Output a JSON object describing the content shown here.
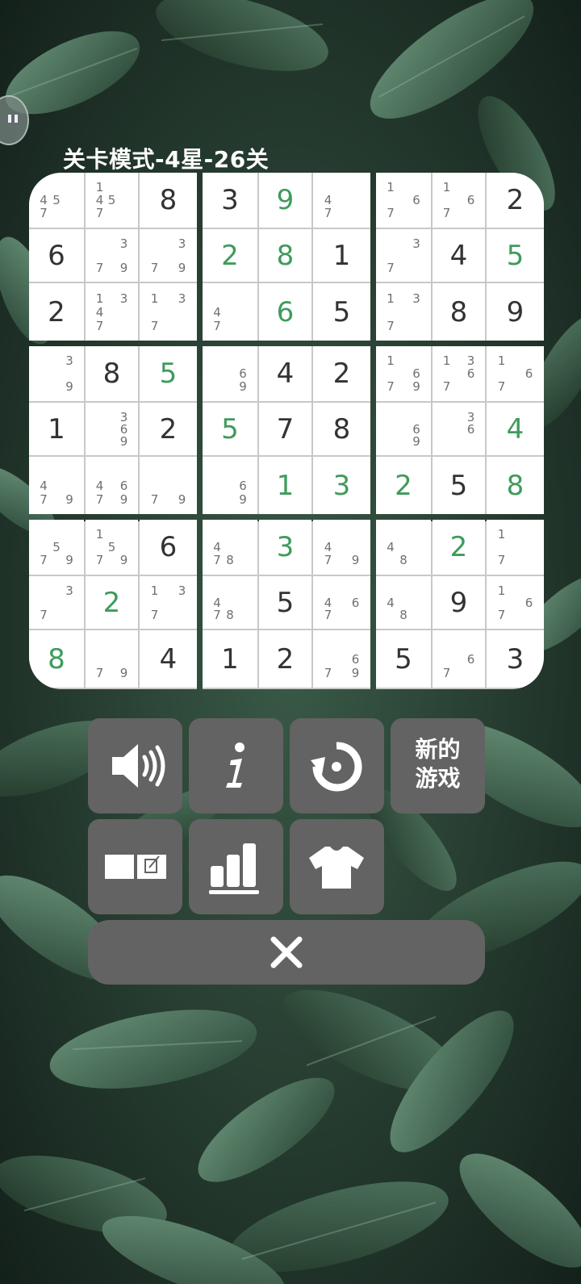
{
  "title": "关卡模式-4星-26关",
  "grid": [
    [
      {
        "n": [
          4,
          5,
          7
        ]
      },
      {
        "n": [
          1,
          4,
          5,
          7
        ]
      },
      {
        "v": 8,
        "g": 1
      },
      {
        "v": 3,
        "g": 1
      },
      {
        "v": 9,
        "g": 0
      },
      {
        "n": [
          4,
          7
        ]
      },
      {
        "n": [
          1,
          6,
          7
        ]
      },
      {
        "n": [
          1,
          6,
          7
        ]
      },
      {
        "v": 2,
        "g": 1
      }
    ],
    [
      {
        "v": 6,
        "g": 1
      },
      {
        "n": [
          3,
          7,
          9
        ]
      },
      {
        "n": [
          3,
          7,
          9
        ]
      },
      {
        "v": 2,
        "g": 0
      },
      {
        "v": 8,
        "g": 0
      },
      {
        "v": 1,
        "g": 1
      },
      {
        "n": [
          3,
          7
        ]
      },
      {
        "v": 4,
        "g": 1
      },
      {
        "v": 5,
        "g": 0
      }
    ],
    [
      {
        "v": 2,
        "g": 1
      },
      {
        "n": [
          1,
          3,
          4,
          7
        ]
      },
      {
        "n": [
          1,
          3,
          7
        ]
      },
      {
        "n": [
          4,
          7
        ]
      },
      {
        "v": 6,
        "g": 0
      },
      {
        "v": 5,
        "g": 1
      },
      {
        "n": [
          1,
          3,
          7
        ]
      },
      {
        "v": 8,
        "g": 1
      },
      {
        "v": 9,
        "g": 1
      }
    ],
    [
      {
        "n": [
          3,
          9
        ]
      },
      {
        "v": 8,
        "g": 1
      },
      {
        "v": 5,
        "g": 0
      },
      {
        "n": [
          6,
          9
        ]
      },
      {
        "v": 4,
        "g": 1
      },
      {
        "v": 2,
        "g": 1
      },
      {
        "n": [
          1,
          6,
          7,
          9
        ]
      },
      {
        "n": [
          1,
          3,
          6,
          7
        ]
      },
      {
        "n": [
          1,
          6,
          7
        ]
      }
    ],
    [
      {
        "v": 1,
        "g": 1
      },
      {
        "n": [
          3,
          6,
          9
        ]
      },
      {
        "v": 2,
        "g": 1
      },
      {
        "v": 5,
        "g": 0
      },
      {
        "v": 7,
        "g": 1
      },
      {
        "v": 8,
        "g": 1
      },
      {
        "n": [
          6,
          9
        ]
      },
      {
        "n": [
          3,
          6
        ]
      },
      {
        "v": 4,
        "g": 0
      }
    ],
    [
      {
        "n": [
          4,
          7,
          9
        ]
      },
      {
        "n": [
          4,
          6,
          7,
          9
        ]
      },
      {
        "n": [
          7,
          9
        ]
      },
      {
        "n": [
          6,
          9
        ]
      },
      {
        "v": 1,
        "g": 0
      },
      {
        "v": 3,
        "g": 0
      },
      {
        "v": 2,
        "g": 0
      },
      {
        "v": 5,
        "g": 1
      },
      {
        "v": 8,
        "g": 0
      }
    ],
    [
      {
        "n": [
          5,
          7,
          9
        ]
      },
      {
        "n": [
          1,
          5,
          7,
          9
        ]
      },
      {
        "v": 6,
        "g": 1
      },
      {
        "n": [
          4,
          7,
          8
        ]
      },
      {
        "v": 3,
        "g": 0
      },
      {
        "n": [
          4,
          7,
          9
        ]
      },
      {
        "n": [
          4,
          8
        ]
      },
      {
        "v": 2,
        "g": 0
      },
      {
        "n": [
          1,
          7
        ]
      }
    ],
    [
      {
        "n": [
          3,
          7
        ]
      },
      {
        "v": 2,
        "g": 0
      },
      {
        "n": [
          1,
          3,
          7
        ]
      },
      {
        "n": [
          4,
          7,
          8
        ]
      },
      {
        "v": 5,
        "g": 1
      },
      {
        "n": [
          4,
          6,
          7
        ]
      },
      {
        "n": [
          4,
          8
        ]
      },
      {
        "v": 9,
        "g": 1
      },
      {
        "n": [
          1,
          6,
          7
        ]
      }
    ],
    [
      {
        "v": 8,
        "g": 0
      },
      {
        "n": [
          7,
          9
        ]
      },
      {
        "v": 4,
        "g": 1
      },
      {
        "v": 1,
        "g": 1
      },
      {
        "v": 2,
        "g": 1
      },
      {
        "n": [
          6,
          7,
          9
        ]
      },
      {
        "v": 5,
        "g": 1
      },
      {
        "n": [
          6,
          7
        ]
      },
      {
        "v": 3,
        "g": 1
      }
    ]
  ],
  "colors": {
    "given": "#333333",
    "user": "#3f9b5c",
    "note": "#707070",
    "button": "#636363"
  },
  "buttons": {
    "sound_icon": "speaker-icon",
    "info_icon": "info-icon",
    "restart_icon": "restart-icon",
    "new_game_line1": "新的",
    "new_game_line2": "游戏",
    "notes_icon": "notes-toggle-icon",
    "stats_icon": "stats-icon",
    "theme_icon": "tshirt-icon",
    "close_icon": "close-icon"
  }
}
